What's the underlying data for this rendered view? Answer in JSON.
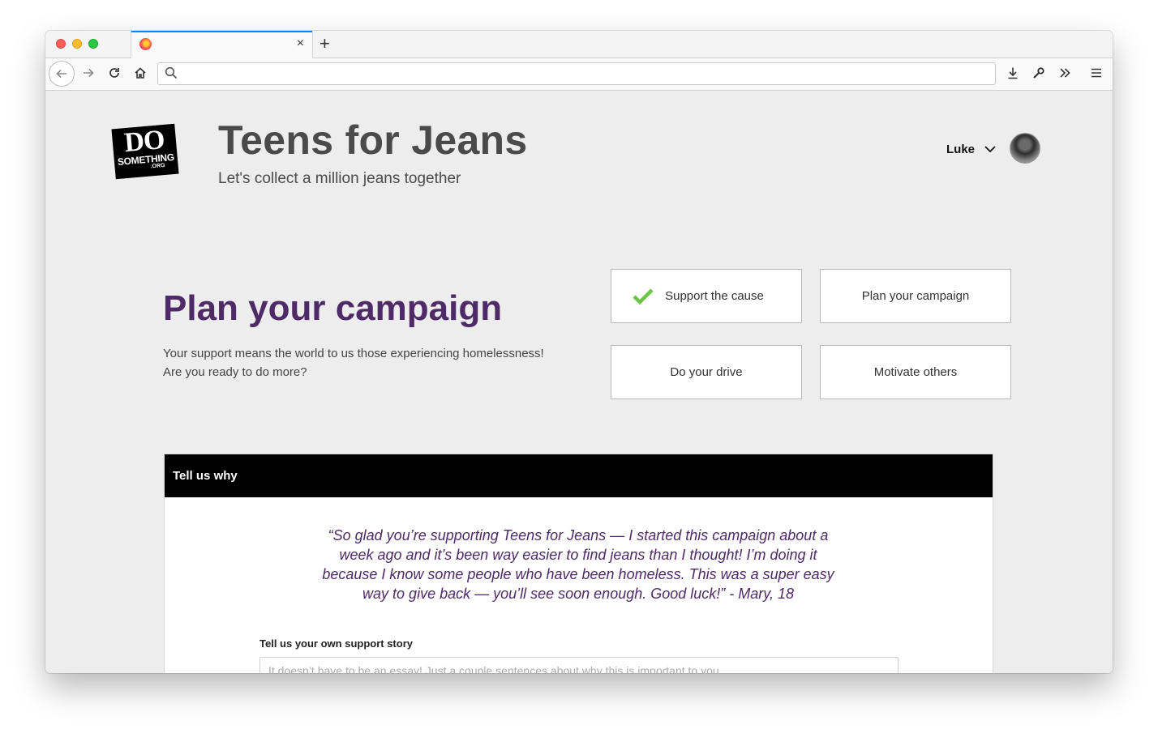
{
  "browser": {
    "tab_close": "×",
    "new_tab": "+",
    "url": ""
  },
  "site": {
    "logo": {
      "line1": "DO",
      "line2": "SOMETHING",
      "line3": ".ORG"
    },
    "title": "Teens for Jeans",
    "subtitle": "Let's collect a million jeans together",
    "user_name": "Luke"
  },
  "campaign": {
    "heading": "Plan your campaign",
    "description_line1": "Your support means the world to us those experiencing homelessness!",
    "description_line2": "Are you ready to do more?"
  },
  "steps": [
    {
      "label": "Support the cause",
      "completed": true
    },
    {
      "label": "Plan your campaign",
      "completed": false
    },
    {
      "label": "Do your drive",
      "completed": false
    },
    {
      "label": "Motivate others",
      "completed": false
    }
  ],
  "card": {
    "header": "Tell us why",
    "quote": "“So glad you’re supporting Teens for Jeans — I started this campaign about a week ago and it’s been way easier to find jeans than I thought! I’m doing it because I know some people who have been homeless. This was a super easy way to give back — you’ll see soon enough. Good luck!” - Mary, 18",
    "story_label": "Tell us your own support story",
    "story_placeholder": "It doesn’t have to be an essay! Just a couple sentences about why this is important to you."
  },
  "colors": {
    "accent_purple": "#4e2a66",
    "check_green": "#6cc644",
    "tab_highlight": "#0a84ff"
  }
}
